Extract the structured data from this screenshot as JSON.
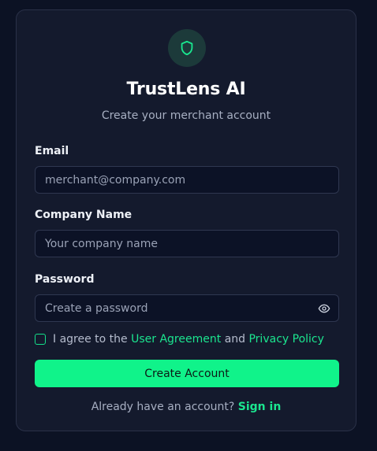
{
  "brand": {
    "title": "TrustLens AI",
    "subtitle": "Create your merchant account",
    "logo_icon": "shield-icon"
  },
  "form": {
    "email": {
      "label": "Email",
      "placeholder": "merchant@company.com"
    },
    "company": {
      "label": "Company Name",
      "placeholder": "Your company name"
    },
    "password": {
      "label": "Password",
      "placeholder": "Create a password",
      "toggle_icon": "eye-icon"
    },
    "agreement": {
      "prefix": "I agree to the",
      "user_agreement": "User Agreement",
      "and": "and",
      "privacy_policy": "Privacy Policy",
      "checked": false
    },
    "submit_label": "Create Account"
  },
  "footer": {
    "prompt": "Already have an account?",
    "signin_label": "Sign in"
  },
  "colors": {
    "background": "#0c1224",
    "card": "#141a2d",
    "accent": "#10f38a"
  }
}
